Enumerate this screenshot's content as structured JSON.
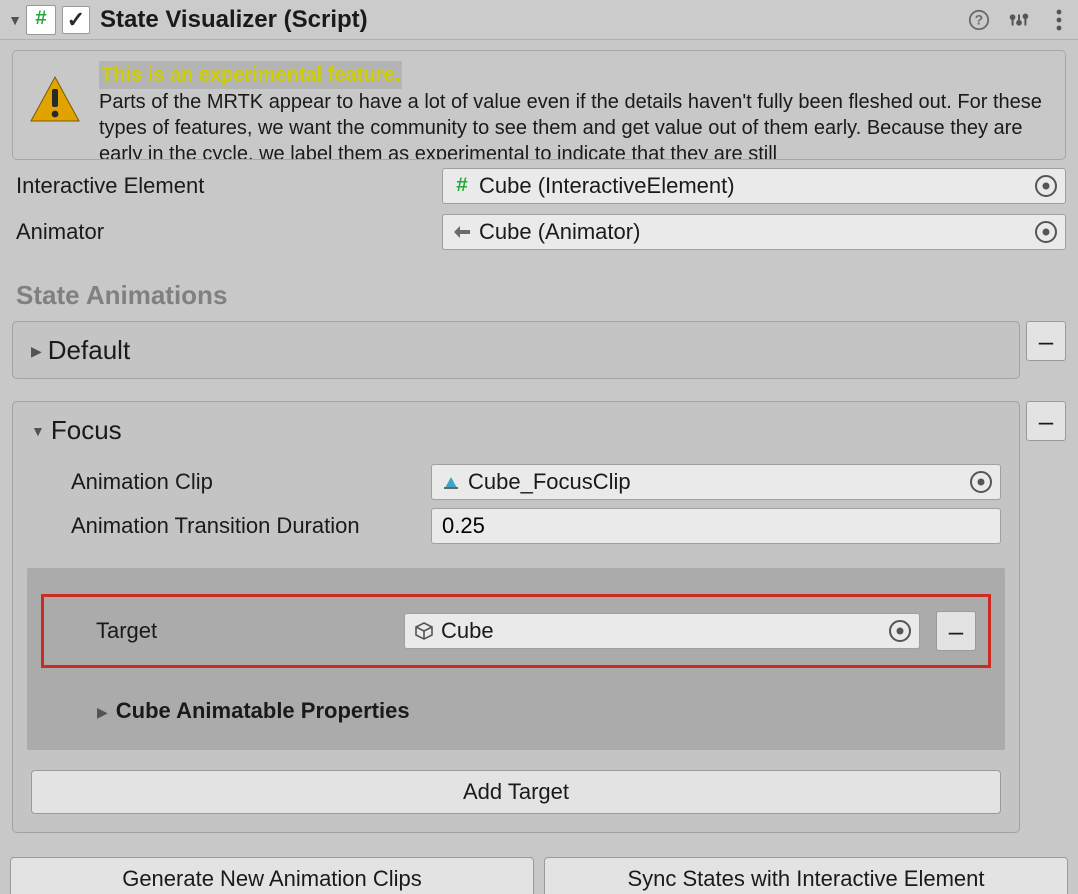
{
  "header": {
    "title": "State Visualizer (Script)",
    "enabled": true
  },
  "warning": {
    "headline": "This is an experimental feature.",
    "body": "Parts of the MRTK appear to have a lot of value even if the details haven't fully been fleshed out. For these types of features, we want the community to see them and get value out of them early. Because they are early in the cycle, we label them as experimental to indicate that they are still"
  },
  "props": {
    "interactive_label": "Interactive Element",
    "interactive_value": "Cube (InteractiveElement)",
    "animator_label": "Animator",
    "animator_value": "Cube (Animator)"
  },
  "sections": {
    "state_animations": "State Animations"
  },
  "states": {
    "default": {
      "title": "Default"
    },
    "focus": {
      "title": "Focus",
      "clip_label": "Animation Clip",
      "clip_value": "Cube_FocusClip",
      "duration_label": "Animation Transition Duration",
      "duration_value": "0.25",
      "target_label": "Target",
      "target_value": "Cube",
      "animatable_label": "Cube Animatable Properties",
      "add_target_label": "Add Target"
    }
  },
  "footer": {
    "generate": "Generate New Animation Clips",
    "sync": "Sync States with Interactive Element"
  },
  "glyphs": {
    "minus": "–"
  }
}
